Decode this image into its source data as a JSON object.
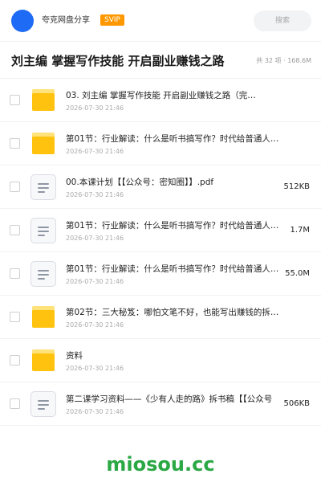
{
  "header": {
    "user_name": "夸克网盘分享",
    "badge": "SVIP",
    "search_placeholder": "搜索"
  },
  "folder": {
    "title": "刘主编 掌握写作技能 开启副业赚钱之路",
    "meta": "共 32 项 · 168.6M"
  },
  "files": [
    {
      "type": "folder",
      "name": "03. 刘主编 掌握写作技能 开启副业赚钱之路（完…",
      "date": "2026-07-30 21:46",
      "size": ""
    },
    {
      "type": "folder",
      "name": "第01节：行业解读：什么是听书搞写作？时代给普通人…",
      "date": "2026-07-30 21:46",
      "size": ""
    },
    {
      "type": "file",
      "name": "00.本课计划【【公众号：密知圈】】.pdf",
      "date": "2026-07-30 21:46",
      "size": "512KB"
    },
    {
      "type": "file",
      "name": "第01节：行业解读：什么是听书搞写作？时代给普通人…",
      "date": "2026-07-30 21:46",
      "size": "1.7M"
    },
    {
      "type": "file",
      "name": "第01节：行业解读：什么是听书搞写作？时代给普通人…",
      "date": "2026-07-30 21:46",
      "size": "55.0M"
    },
    {
      "type": "folder",
      "name": "第02节：三大秘笈：哪怕文笔不好，也能写出赚钱的拆…",
      "date": "2026-07-30 21:46",
      "size": ""
    },
    {
      "type": "folder",
      "name": "资料",
      "date": "2026-07-30 21:46",
      "size": ""
    },
    {
      "type": "file",
      "name": "第二课学习资料——《少有人走的路》拆书稿【【公众号",
      "date": "2026-07-30 21:46",
      "size": "506KB"
    }
  ],
  "watermark": "miosou.cc",
  "colors": {
    "accent": "#1e6bf5",
    "badge": "#ff9800",
    "folder": "#ffc20e",
    "watermark": "#2aa844"
  }
}
